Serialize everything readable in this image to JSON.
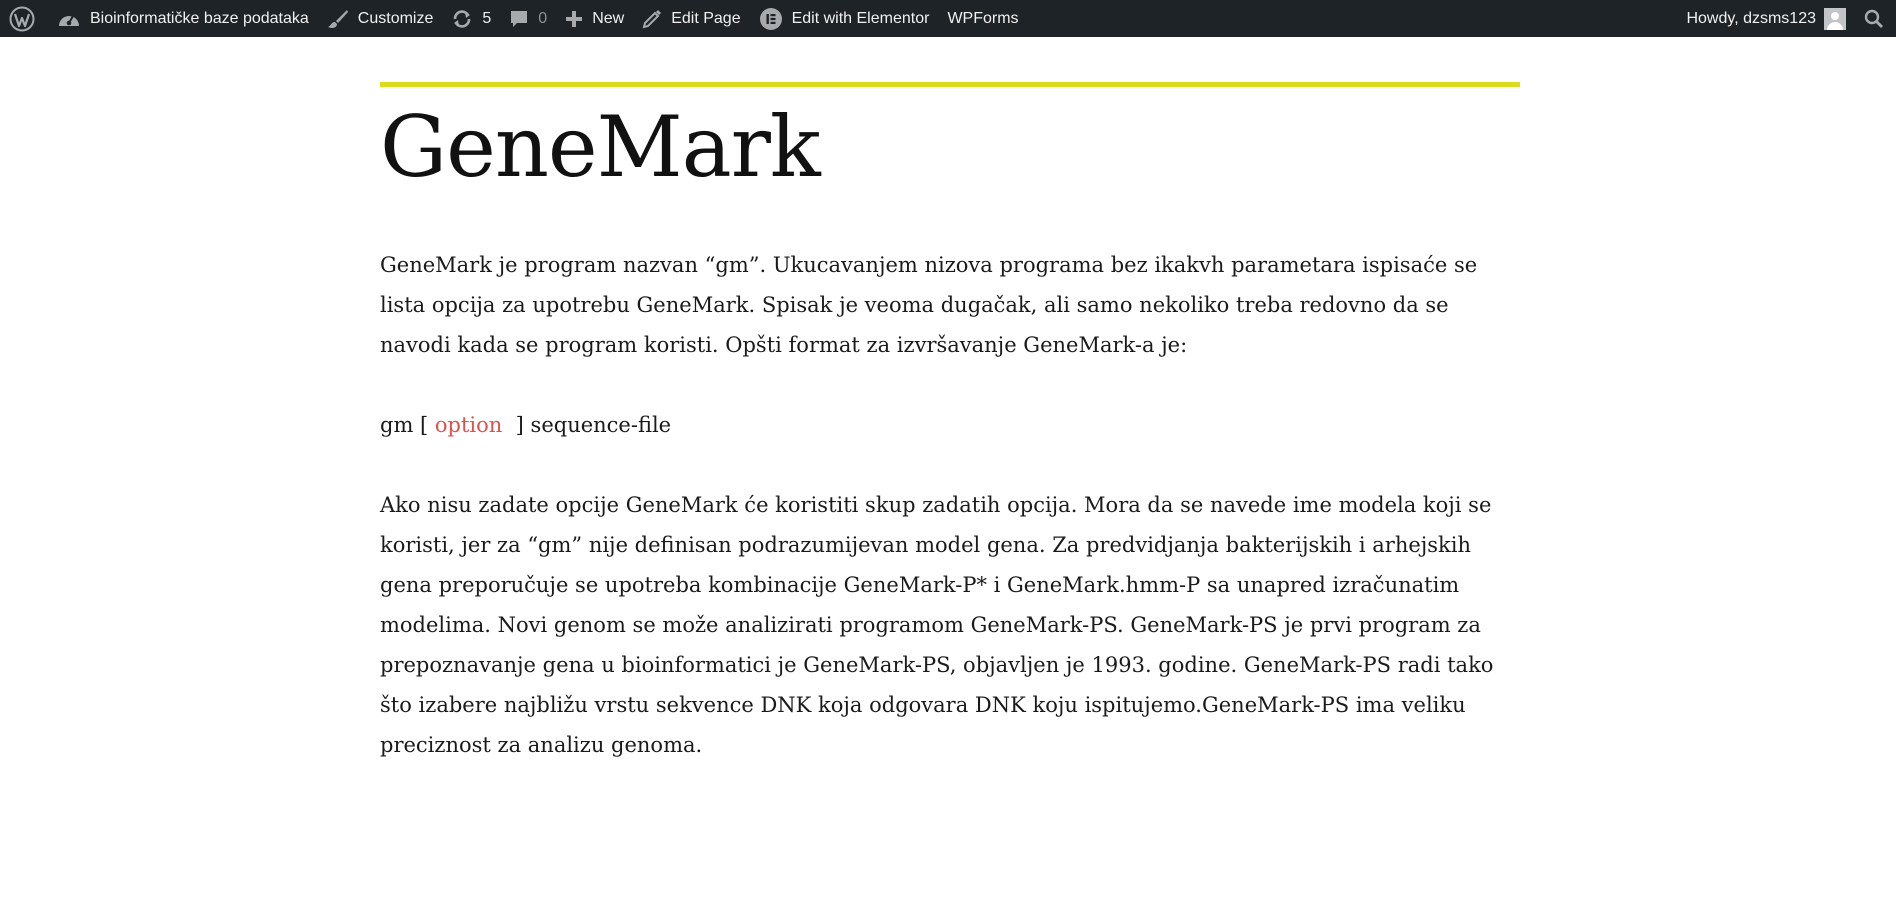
{
  "adminbar": {
    "site_name": "Bioinformatičke baze podataka",
    "customize": "Customize",
    "updates_count": "5",
    "comments_count": "0",
    "new": "New",
    "edit_page": "Edit Page",
    "edit_elementor": "Edit with Elementor",
    "wpforms": "WPForms",
    "howdy": "Howdy, dzsms123"
  },
  "page": {
    "title": "GeneMark",
    "para1": "GeneMark je program nazvan “gm”. Ukucavanjem nizova programa bez ikakvh parametara ispisaće se lista opcija za upotrebu GeneMark. Spisak je veoma dugačak, ali samo nekoliko treba redovno da se navodi kada se program koristi. Opšti format za izvršavanje GeneMark-a je:",
    "syntax": {
      "before": "gm [ ",
      "option": "option",
      "after": "  ] sequence-file"
    },
    "para2": "Ako nisu zadate opcije GeneMark će koristiti skup zadatih opcija. Mora da se navede ime modela koji se koristi, jer za “gm” nije definisan podrazumijevan model gena. Za predvidjanja bakterijskih i arhejskih gena preporučuje se upotreba kombinacije GeneMark-P* i GeneMark.hmm-P sa unapred izračunatim modelima. Novi genom se može analizirati programom GeneMark-PS. GeneMark-PS je prvi program za prepoznavanje gena u bioinformatici je GeneMark-PS, objavljen je 1993. godine. GeneMark-PS radi tako što izabere najbližu vrstu sekvence DNK koja odgovara DNK koju ispitujemo.GeneMark-PS ima veliku preciznost za analizu genoma."
  },
  "colors": {
    "adminbar_bg": "#1d2327",
    "title_rule": "#dcdc1f",
    "option_text": "#d9534f"
  },
  "icons": [
    "wordpress-icon",
    "dashboard-icon",
    "brush-icon",
    "updates-icon",
    "comment-icon",
    "plus-icon",
    "pencil-icon",
    "elementor-icon",
    "avatar",
    "search-icon"
  ]
}
